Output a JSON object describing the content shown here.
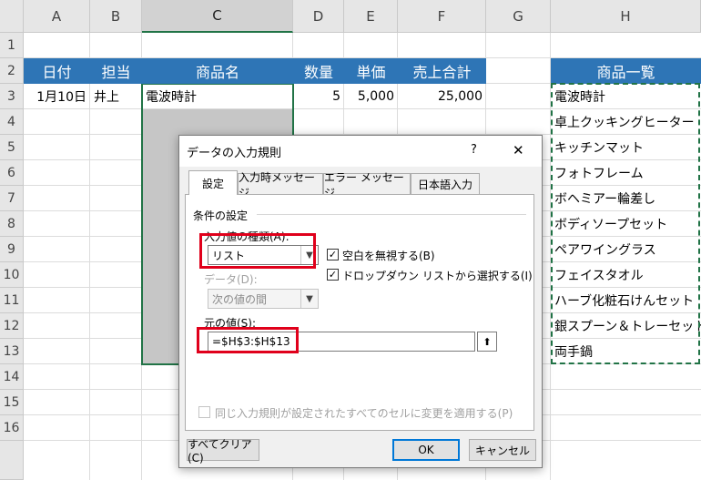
{
  "sheet": {
    "columns": [
      "A",
      "B",
      "C",
      "D",
      "E",
      "F",
      "G",
      "H"
    ],
    "rows": [
      "1",
      "2",
      "3",
      "4",
      "5",
      "6",
      "7",
      "8",
      "9",
      "10",
      "11",
      "12",
      "13",
      "14",
      "15",
      "16"
    ],
    "headers": {
      "date": "日付",
      "person": "担当",
      "product": "商品名",
      "qty": "数量",
      "price": "単価",
      "total": "売上合計",
      "list": "商品一覧"
    },
    "row3": {
      "date": "1月10日",
      "person": "井上",
      "product": "電波時計",
      "qty": "5",
      "price": "5,000",
      "total": "25,000"
    },
    "product_list": [
      "電波時計",
      "卓上クッキングヒーター",
      "キッチンマット",
      "フォトフレーム",
      "ボヘミアー輪差し",
      "ボディソープセット",
      "ペアワイングラス",
      "フェイスタオル",
      "ハーブ化粧石けんセット",
      "銀スプーン＆トレーセット",
      "両手鍋"
    ]
  },
  "dialog": {
    "title": "データの入力規則",
    "help": "?",
    "close": "✕",
    "tabs": [
      "設定",
      "入力時メッセージ",
      "エラー メッセージ",
      "日本語入力"
    ],
    "group_label": "条件の設定",
    "allow_label": "入力値の種類(A):",
    "allow_value": "リスト",
    "ignore_blank": "空白を無視する(B)",
    "dropdown": "ドロップダウン リストから選択する(I)",
    "data_label": "データ(D):",
    "data_value": "次の値の間",
    "source_label": "元の値(S):",
    "source_value": "=$H$3:$H$13",
    "apply_all": "同じ入力規則が設定されたすべてのセルに変更を適用する(P)",
    "clear_all": "すべてクリア(C)",
    "ok": "OK",
    "cancel": "キャンセル"
  },
  "colors": {
    "header_blue": "#2e75b6",
    "highlight_red": "#e0001b",
    "excel_green": "#217346"
  }
}
